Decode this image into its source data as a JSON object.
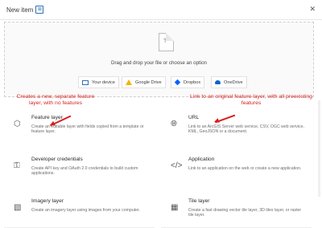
{
  "header": {
    "title": "New item",
    "close_icon": "close-icon"
  },
  "dropzone": {
    "icon": "file-icon",
    "text": "Drag and drop your file or choose an option",
    "sources": [
      {
        "label": "Your device",
        "icon": "device-icon"
      },
      {
        "label": "Google Drive",
        "icon": "google-drive-icon"
      },
      {
        "label": "Dropbox",
        "icon": "dropbox-icon"
      },
      {
        "label": "OneDrive",
        "icon": "onedrive-icon"
      }
    ]
  },
  "items": [
    {
      "title": "Feature layer",
      "desc": "Create an editable layer with fields copied from a template or feature layer.",
      "icon": "feature-layer-icon"
    },
    {
      "title": "URL",
      "desc": "Link to an ArcGIS Server web service, CSV, OGC web service, KML, GeoJSON or a document.",
      "icon": "globe-icon"
    },
    {
      "title": "Developer credentials",
      "desc": "Create API key and OAuth 2.0 credentials to build custom applications.",
      "icon": "key-icon"
    },
    {
      "title": "Application",
      "desc": "Link to an application on the web or create a new application.",
      "icon": "code-icon"
    },
    {
      "title": "Imagery layer",
      "desc": "Create an imagery layer using images from your computer.",
      "icon": "imagery-icon"
    },
    {
      "title": "Tile layer",
      "desc": "Create a fast drawing vector tile layer, 3D tiles layer, or raster tile layer.",
      "icon": "tile-layer-icon"
    }
  ],
  "annotations": {
    "left": "Creates a new, separate feature layer, with no features",
    "right": "Link to an original feature layer, with all preexisting features"
  },
  "colors": {
    "annotation": "#d71f1f",
    "accent": "#2f6fb5"
  }
}
